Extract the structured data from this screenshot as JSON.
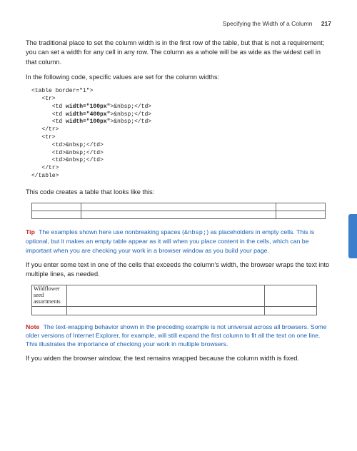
{
  "header": {
    "section": "Specifying the Width of a Column",
    "page_number": "217"
  },
  "para1": "The traditional place to set the column width is in the first row of the table, but that is not a requirement; you can set a width for any cell in any row. The column as a whole will be as wide as the widest cell in that column.",
  "para2": "In the following code, specific values are set for the column widths:",
  "code": {
    "l1": "<table border=\"1\">",
    "l2": "   <tr>",
    "l3a": "      <td ",
    "l3b": "width=\"100px\"",
    "l3c": ">&nbsp;</td>",
    "l4a": "      <td ",
    "l4b": "width=\"400px\"",
    "l4c": ">&nbsp;</td>",
    "l5a": "      <td ",
    "l5b": "width=\"100px\"",
    "l5c": ">&nbsp;</td>",
    "l6": "   </tr>",
    "l7": "   <tr>",
    "l8": "      <td>&nbsp;</td>",
    "l9": "      <td>&nbsp;</td>",
    "l10": "      <td>&nbsp;</td>",
    "l11": "   </tr>",
    "l12": "</table>"
  },
  "para3": "This code creates a table that looks like this:",
  "tip": {
    "label": "Tip",
    "text_a": "The examples shown here use nonbreaking spaces (",
    "entity": "&nbsp;",
    "text_b": ") as placeholders in empty cells. This is optional, but it makes an empty table appear as it will when you place content in the cells, which can be important when you are checking your work in a browser window as you build your page."
  },
  "para4": "If you enter some text in one of the cells that exceeds the column's width, the browser wraps the text into multiple lines, as needed.",
  "wrap_cell": "Wildflower seed assortments",
  "note": {
    "label": "Note",
    "text": "The text-wrapping behavior shown in the preceding example is not universal across all browsers. Some older versions of Internet Explorer, for example, will still expand the first column to fit all the text on one line. This illustrates the importance of checking your work in multiple browsers."
  },
  "para5": "If you widen the browser window, the text remains wrapped because the column width is fixed."
}
